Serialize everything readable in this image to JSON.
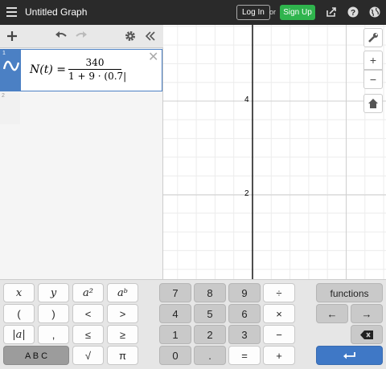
{
  "topbar": {
    "title": "Untitled Graph",
    "login_label": "Log In",
    "or_label": "or",
    "signup_label": "Sign Up",
    "icons": [
      "menu-icon",
      "share-icon",
      "help-icon",
      "globe-icon"
    ]
  },
  "expressions": {
    "header_icons": [
      "add-icon",
      "undo-icon",
      "redo-icon",
      "settings-icon",
      "collapse-icon"
    ],
    "items": [
      {
        "index": "1",
        "lhs": "N(t) =",
        "numerator": "340",
        "denominator": "1 + 9 · (0.7|"
      },
      {
        "index": "2"
      }
    ]
  },
  "graph": {
    "y_tick_labels": [
      "4",
      "2"
    ],
    "side_buttons": [
      "wrench-icon",
      "+",
      "−",
      "home-icon"
    ],
    "accent": "#4b80c4"
  },
  "keypad": {
    "left": [
      [
        "x",
        "y",
        "a²",
        "aᵇ"
      ],
      [
        "(",
        ")",
        "<",
        ">"
      ],
      [
        "|a|",
        ",",
        "≤",
        "≥"
      ],
      [
        "A B C",
        "√",
        "π"
      ]
    ],
    "digits": [
      [
        "7",
        "8",
        "9",
        "÷"
      ],
      [
        "4",
        "5",
        "6",
        "×"
      ],
      [
        "1",
        "2",
        "3",
        "−"
      ],
      [
        "0",
        ".",
        "=",
        "+"
      ]
    ],
    "functions_label": "functions",
    "left_arrow": "←",
    "right_arrow": "→",
    "backspace": "⌫",
    "enter": "↵"
  }
}
